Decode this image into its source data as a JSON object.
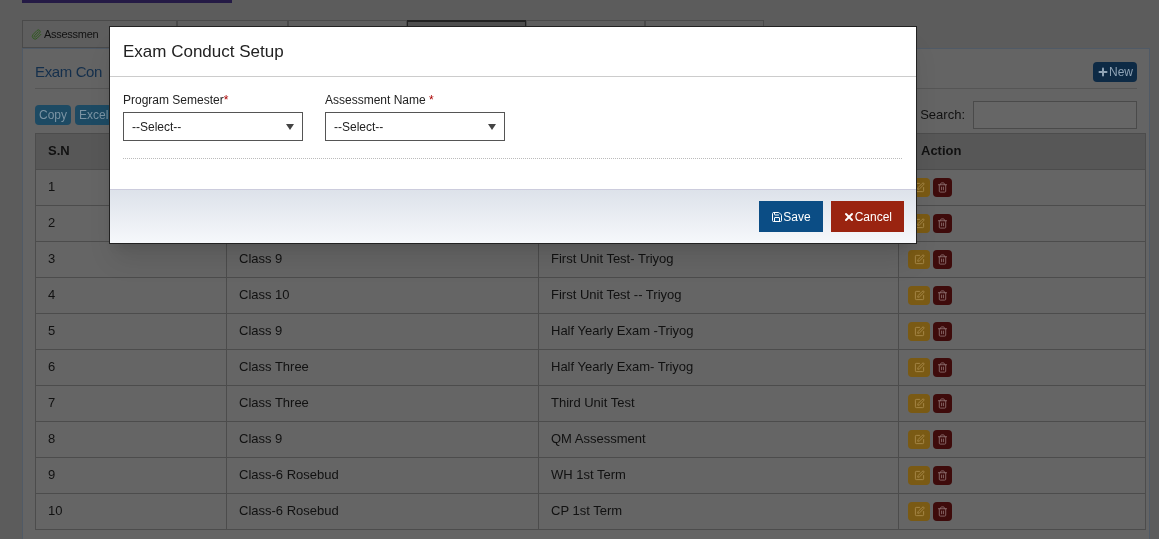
{
  "tabs": [
    {
      "label": "Assessmen",
      "selected": false
    },
    {
      "selected": false
    },
    {
      "selected": false
    },
    {
      "selected": true
    },
    {
      "selected": false
    },
    {
      "selected": false
    }
  ],
  "panel": {
    "title": "Exam Con",
    "new_button": "New",
    "export_buttons": [
      "Copy",
      "Excel"
    ],
    "search_label": "Search:"
  },
  "table": {
    "columns": [
      "S.N",
      null,
      null,
      "Action"
    ],
    "rows": [
      {
        "sn": "1"
      },
      {
        "sn": "2"
      },
      {
        "sn": "3",
        "program": "Class 9",
        "assessment": "First Unit Test- Triyog"
      },
      {
        "sn": "4",
        "program": "Class 10",
        "assessment": "First Unit Test -- Triyog"
      },
      {
        "sn": "5",
        "program": "Class 9",
        "assessment": "Half Yearly Exam -Triyog"
      },
      {
        "sn": "6",
        "program": "Class Three",
        "assessment": "Half Yearly Exam- Triyog"
      },
      {
        "sn": "7",
        "program": "Class Three",
        "assessment": "Third Unit Test"
      },
      {
        "sn": "8",
        "program": "Class 9",
        "assessment": "QM Assessment"
      },
      {
        "sn": "9",
        "program": "Class-6 Rosebud",
        "assessment": "WH 1st Term"
      },
      {
        "sn": "10",
        "program": "Class-6 Rosebud",
        "assessment": "CP 1st Term"
      }
    ]
  },
  "modal": {
    "title": "Exam Conduct Setup",
    "fields": [
      {
        "label": "Program Semester",
        "required_mark": "*",
        "value": "--Select--"
      },
      {
        "label": "Assessment Name ",
        "required_mark": "*",
        "value": "--Select--"
      }
    ],
    "save_button": "Save",
    "cancel_button": "Cancel"
  }
}
